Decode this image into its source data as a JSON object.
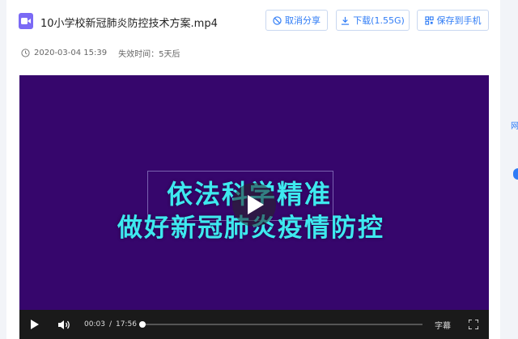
{
  "file": {
    "title": "10小学校新冠肺炎防控技术方案.mp4",
    "icon": "video-file-icon",
    "icon_color": "#7b6af5"
  },
  "actions": {
    "cancel_share": "取消分享",
    "download": "下载(1.55G)",
    "save_to_phone": "保存到手机",
    "accent_color": "#2f7cf6"
  },
  "meta": {
    "date": "2020-03-04 15:39",
    "expire_label": "失效时间：",
    "expire_value": "5天后"
  },
  "video": {
    "background_color": "#36066c",
    "headline_line1": "依法科学精准",
    "headline_line2": "做好新冠肺炎疫情防控",
    "headline_color": "#3ee9ef",
    "current_time": "00:03",
    "time_separator": "/",
    "duration": "17:56",
    "progress_fraction": 0.003,
    "subtitle_label": "字幕"
  },
  "side": {
    "text": "网"
  }
}
